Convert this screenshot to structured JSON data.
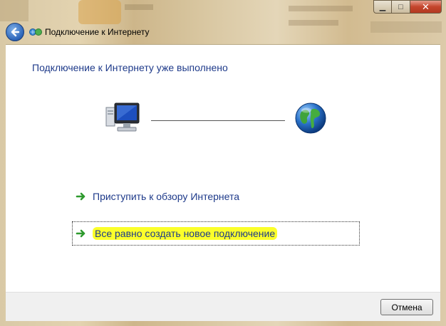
{
  "window": {
    "title": "Подключение к Интернету",
    "caption": {
      "minimize": "▁",
      "maximize": "□",
      "close": "✕"
    }
  },
  "main": {
    "heading": "Подключение к Интернету уже выполнено",
    "links": [
      {
        "label": "Приступить к обзору Интернета",
        "icon": "green-arrow-icon",
        "focused": false
      },
      {
        "label": "Все равно создать новое подключение",
        "icon": "green-arrow-icon",
        "focused": true,
        "highlighted": true
      }
    ]
  },
  "footer": {
    "cancel_label": "Отмена"
  },
  "icons": {
    "back": "back-arrow-icon",
    "title": "network-connection-icon",
    "computer": "computer-icon",
    "globe": "globe-icon"
  },
  "colors": {
    "link_text": "#1e3a8a",
    "highlight": "#fbff2a",
    "arrow_green": "#2e9a2e"
  }
}
